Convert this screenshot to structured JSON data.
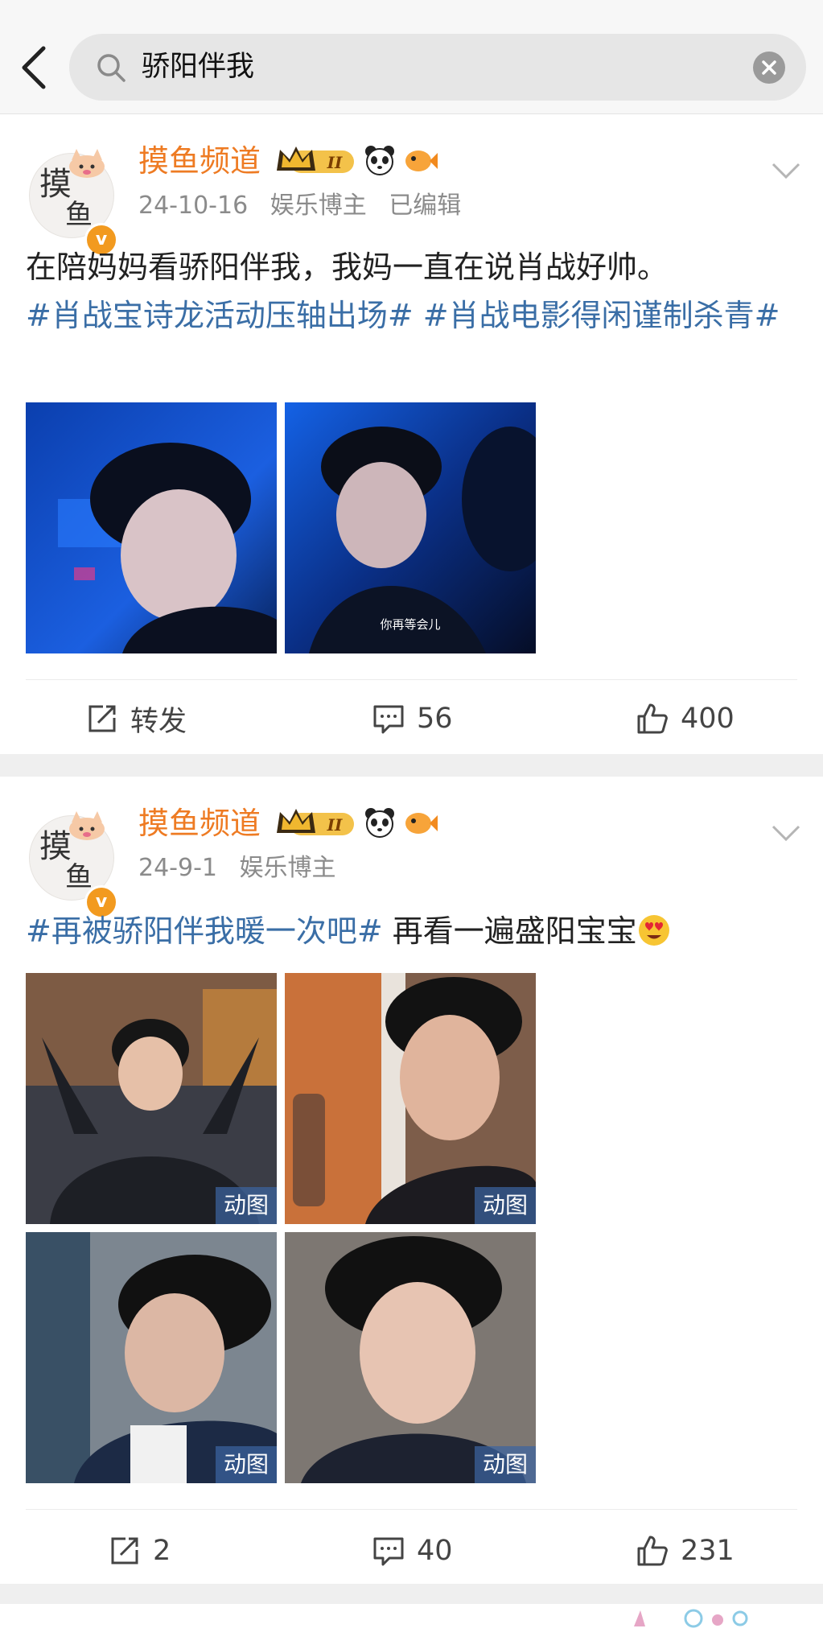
{
  "search": {
    "query": "骄阳伴我"
  },
  "posts": [
    {
      "username": "摸鱼频道",
      "crown_level": "II",
      "date": "24-10-16",
      "category": "娱乐博主",
      "edited": "已编辑",
      "text_plain": "在陪妈妈看骄阳伴我，我妈一直在说肖战好帅。",
      "hashtag_1": "#肖战宝诗龙活动压轴出场#",
      "hashtag_2": "#肖战电影得闲谨制杀青#",
      "image_2_subtitle": "你再等会儿",
      "repost_label": "转发",
      "comments": "56",
      "likes": "400"
    },
    {
      "username": "摸鱼频道",
      "crown_level": "II",
      "date": "24-9-1",
      "category": "娱乐博主",
      "hashtag_1": "#再被骄阳伴我暖一次吧#",
      "text_plain": " 再看一遍盛阳宝宝",
      "gif_label": "动图",
      "reposts": "2",
      "comments": "40",
      "likes": "231"
    }
  ],
  "colors": {
    "username": "#ee7b23",
    "hashtag": "#3a6ea6",
    "meta": "#8b8b8b"
  },
  "icons": [
    "back-arrow-icon",
    "search-icon",
    "clear-icon",
    "chevron-down-icon",
    "repost-icon",
    "comment-icon",
    "like-icon",
    "heart-eyes-emoji-icon"
  ]
}
